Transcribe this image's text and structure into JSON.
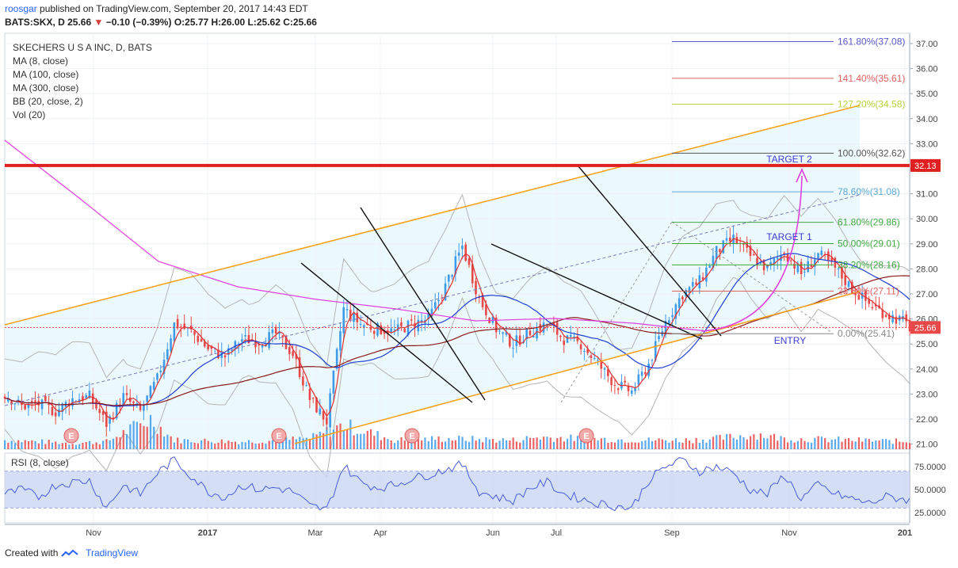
{
  "header": {
    "user": "roosgar",
    "published_text": "published on TradingView.com, September 20, 2017 14:43 EDT",
    "symbol": "BATS:SKX, D",
    "last": "25.66",
    "change": "−0.10 (−0.39%)",
    "ohlc": "O:25.77 H:26.00 L:25.62 C:25.66"
  },
  "indicators": [
    "SKECHERS U S A INC, D, BATS",
    "MA (8, close)",
    "MA (100, close)",
    "MA (300, close)",
    "BB (20, close, 2)",
    "Vol (20)"
  ],
  "rsi_label": "RSI (8, close)",
  "footer": {
    "created_with": "Created with",
    "brand": "TradingView"
  },
  "colors": {
    "up": "#3d9be9",
    "down": "#e84848",
    "ma8": "#e03030",
    "ma100": "#1f3fd0",
    "ma300": "#8b1a1a",
    "channel": "#f7a21b",
    "resistance": "#e02020",
    "fib": "#5a5ac8",
    "arrow": "#e040e0"
  },
  "chart_data": {
    "type": "candlestick",
    "title": "SKECHERS U S A INC, D, BATS",
    "price_axis": {
      "ticks": [
        "37.00",
        "36.00",
        "35.00",
        "34.00",
        "33.00",
        "32.00",
        "31.00",
        "30.00",
        "29.00",
        "28.00",
        "27.00",
        "26.00",
        "25.00",
        "24.00",
        "23.00",
        "22.00",
        "21.00"
      ],
      "ylim": [
        20.85,
        37.5
      ]
    },
    "x_axis": {
      "ticks": [
        "Nov",
        "2017",
        "Mar",
        "Apr",
        "Jun",
        "Jul",
        "Sep",
        "Nov",
        "201"
      ]
    },
    "close_path": [
      [
        0,
        23.0
      ],
      [
        10,
        22.5
      ],
      [
        20,
        22.6
      ],
      [
        30,
        22.3
      ],
      [
        40,
        22.8
      ],
      [
        50,
        22.9
      ],
      [
        60,
        21.8
      ],
      [
        70,
        22.9
      ],
      [
        80,
        22.3
      ],
      [
        90,
        23.6
      ],
      [
        100,
        25.8
      ],
      [
        110,
        25.5
      ],
      [
        120,
        24.8
      ],
      [
        130,
        24.5
      ],
      [
        140,
        25.2
      ],
      [
        150,
        25.1
      ],
      [
        160,
        25.4
      ],
      [
        170,
        24.6
      ],
      [
        180,
        22.8
      ],
      [
        190,
        21.9
      ],
      [
        200,
        26.4
      ],
      [
        210,
        25.8
      ],
      [
        220,
        25.6
      ],
      [
        230,
        25.5
      ],
      [
        240,
        25.8
      ],
      [
        250,
        26.0
      ],
      [
        260,
        27.3
      ],
      [
        270,
        28.9
      ],
      [
        280,
        26.8
      ],
      [
        290,
        25.6
      ],
      [
        300,
        25.0
      ],
      [
        310,
        25.5
      ],
      [
        320,
        25.8
      ],
      [
        330,
        25.2
      ],
      [
        340,
        25.0
      ],
      [
        350,
        24.2
      ],
      [
        360,
        23.4
      ],
      [
        370,
        23.1
      ],
      [
        380,
        24.2
      ],
      [
        390,
        25.9
      ],
      [
        400,
        27.0
      ],
      [
        410,
        27.5
      ],
      [
        420,
        28.7
      ],
      [
        430,
        29.2
      ],
      [
        440,
        28.5
      ],
      [
        450,
        28.0
      ],
      [
        460,
        28.7
      ],
      [
        470,
        27.8
      ],
      [
        480,
        28.6
      ],
      [
        490,
        28.0
      ],
      [
        500,
        27.2
      ],
      [
        510,
        26.6
      ],
      [
        520,
        26.2
      ],
      [
        530,
        25.9
      ],
      [
        534,
        25.66
      ]
    ],
    "volume_path": [
      [
        0,
        0.3
      ],
      [
        20,
        0.25
      ],
      [
        40,
        0.2
      ],
      [
        60,
        0.25
      ],
      [
        86,
        1.0
      ],
      [
        100,
        0.3
      ],
      [
        140,
        0.25
      ],
      [
        180,
        0.35
      ],
      [
        200,
        0.8
      ],
      [
        230,
        0.3
      ],
      [
        260,
        0.35
      ],
      [
        300,
        0.3
      ],
      [
        315,
        0.4
      ],
      [
        340,
        0.35
      ],
      [
        380,
        0.3
      ],
      [
        400,
        0.3
      ],
      [
        420,
        0.35
      ],
      [
        444,
        0.5
      ],
      [
        460,
        0.35
      ],
      [
        500,
        0.3
      ],
      [
        534,
        0.25
      ]
    ],
    "rsi_path": [
      [
        0,
        45
      ],
      [
        10,
        50
      ],
      [
        20,
        42
      ],
      [
        30,
        55
      ],
      [
        40,
        58
      ],
      [
        50,
        60
      ],
      [
        60,
        30
      ],
      [
        70,
        55
      ],
      [
        80,
        45
      ],
      [
        90,
        68
      ],
      [
        100,
        82
      ],
      [
        110,
        65
      ],
      [
        120,
        48
      ],
      [
        130,
        42
      ],
      [
        140,
        55
      ],
      [
        150,
        50
      ],
      [
        160,
        52
      ],
      [
        170,
        48
      ],
      [
        180,
        32
      ],
      [
        190,
        28
      ],
      [
        200,
        76
      ],
      [
        210,
        58
      ],
      [
        220,
        52
      ],
      [
        230,
        55
      ],
      [
        240,
        62
      ],
      [
        250,
        66
      ],
      [
        260,
        72
      ],
      [
        270,
        77
      ],
      [
        280,
        48
      ],
      [
        290,
        42
      ],
      [
        300,
        38
      ],
      [
        310,
        52
      ],
      [
        320,
        58
      ],
      [
        330,
        45
      ],
      [
        340,
        40
      ],
      [
        350,
        35
      ],
      [
        360,
        32
      ],
      [
        370,
        30
      ],
      [
        380,
        60
      ],
      [
        390,
        75
      ],
      [
        400,
        82
      ],
      [
        410,
        70
      ],
      [
        420,
        75
      ],
      [
        430,
        68
      ],
      [
        440,
        50
      ],
      [
        450,
        45
      ],
      [
        460,
        66
      ],
      [
        470,
        40
      ],
      [
        480,
        55
      ],
      [
        490,
        45
      ],
      [
        500,
        40
      ],
      [
        510,
        35
      ],
      [
        520,
        42
      ],
      [
        530,
        40
      ],
      [
        534,
        38
      ]
    ],
    "rsi_axis": {
      "ticks": [
        "75.0000",
        "50.0000",
        "25.0000"
      ],
      "band": [
        30,
        70
      ]
    },
    "fibonacci": [
      {
        "label": "161.80%(37.08)",
        "value": 37.08,
        "color": "#5a5ac8"
      },
      {
        "label": "141.40%(35.61)",
        "value": 35.61,
        "color": "#e06060"
      },
      {
        "label": "127.20%(34.58)",
        "value": 34.58,
        "color": "#b8d040"
      },
      {
        "label": "100.00%(32.62)",
        "value": 32.62,
        "color": "#555555"
      },
      {
        "label": "78.60%(31.08)",
        "value": 31.08,
        "color": "#5aa8d8"
      },
      {
        "label": "61.80%(29.86)",
        "value": 29.86,
        "color": "#40a840"
      },
      {
        "label": "50.00%(29.01)",
        "value": 29.01,
        "color": "#40a840"
      },
      {
        "label": "38.20%(28.16)",
        "value": 28.16,
        "color": "#40a840"
      },
      {
        "label": "23.60%(27.11)",
        "value": 27.11,
        "color": "#e06060"
      },
      {
        "label": "0.00%(25.41)",
        "value": 25.41,
        "color": "#888888"
      }
    ],
    "resistance": {
      "value": 32.13,
      "label": "32.13"
    },
    "last_price": {
      "value": 25.66,
      "label": "25.66"
    },
    "annotations": [
      {
        "text": "TARGET 2"
      },
      {
        "text": "TARGET 1"
      },
      {
        "text": "ENTRY"
      }
    ],
    "earnings_marker": "E"
  }
}
